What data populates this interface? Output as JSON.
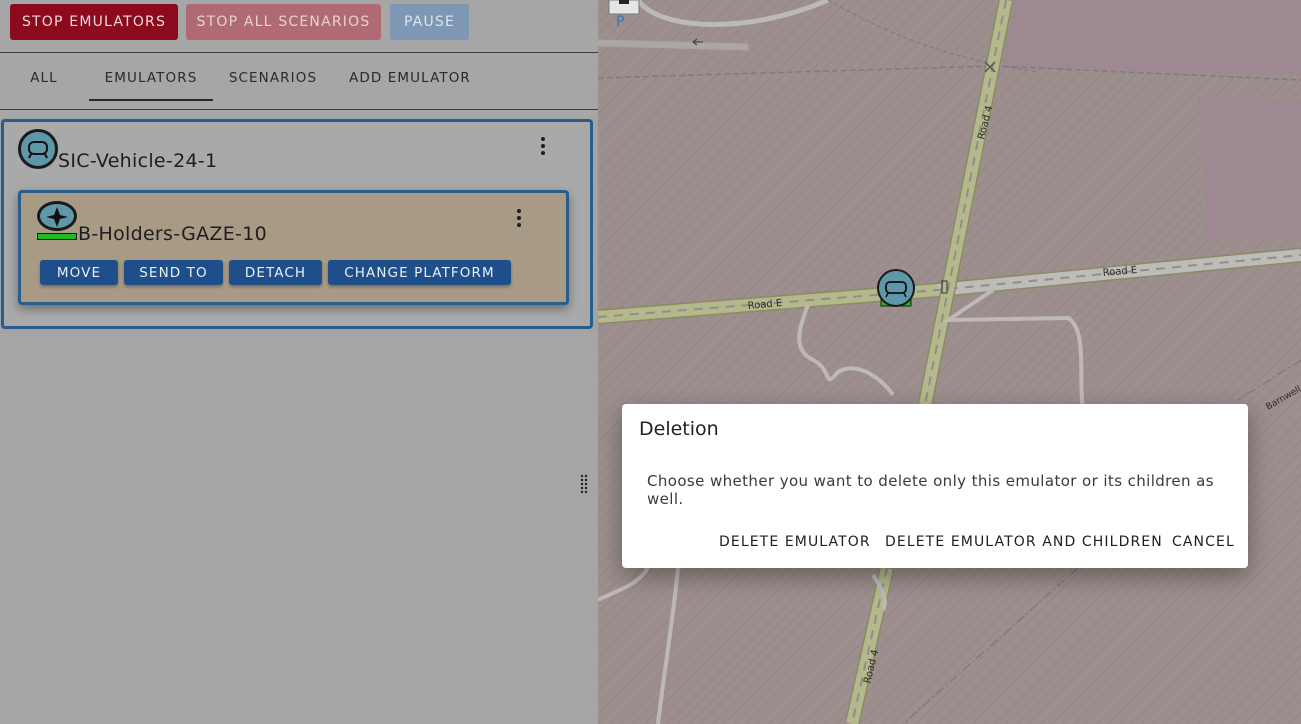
{
  "toolbar": {
    "stop_emulators": "STOP EMULATORS",
    "stop_all_scenarios": "STOP ALL SCENARIOS",
    "pause": "PAUSE"
  },
  "tabs": [
    {
      "label": "ALL"
    },
    {
      "label": "EMULATORS",
      "active": true
    },
    {
      "label": "SCENARIOS"
    },
    {
      "label": "ADD EMULATOR"
    }
  ],
  "emulator": {
    "name": "SIC-Vehicle-24-1",
    "icon": "vehicle-icon",
    "child": {
      "name": "B-Holders-GAZE-10",
      "icon": "sensor-icon",
      "status_color": "#1fb81f",
      "actions": [
        "MOVE",
        "SEND TO",
        "DETACH",
        "CHANGE PLATFORM"
      ]
    }
  },
  "map": {
    "road_labels": [
      "Road 4",
      "Road E",
      "Road E",
      "Road 4",
      "Barnwell"
    ],
    "parking_symbol": "P"
  },
  "dialog": {
    "title": "Deletion",
    "message": "Choose whether you want to delete only this emulator or its children as well.",
    "delete_emulator": "DELETE EMULATOR",
    "delete_with_children": "DELETE EMULATOR AND CHILDREN",
    "cancel": "CANCEL"
  },
  "colors": {
    "danger": "#8b0a1e",
    "primary": "#1f4f8a",
    "card_border": "#2b5d8c"
  }
}
